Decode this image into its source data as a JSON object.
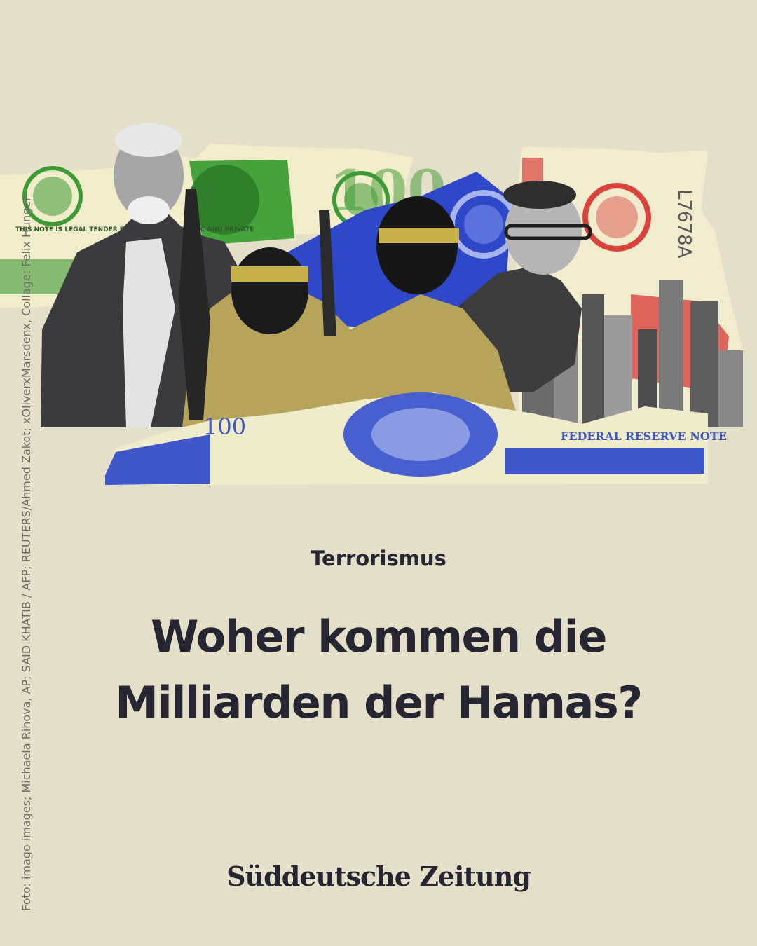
{
  "credit": "Foto: imago images; Michaela Rihova, AP; SAID KHATIB / AFP; REUTERS/Ahmed Zakot; xOliverxMarsdenx, Collage: Felix Hunger",
  "kicker": "Terrorismus",
  "headline": {
    "line1": "Woher kommen die",
    "line2": "Milliarden der Hamas?"
  },
  "brand": "Süddeutsche Zeitung",
  "collage": {
    "note_left_text": "THIS NOTE IS LEGAL TENDER FOR ALL DEBTS, PUBLIC AND PRIVATE",
    "note_left_serial": "100",
    "note_right_serial": "L7678A",
    "note_bottom_text": "FEDERAL RESERVE NOTE",
    "note_bottom_value": "100"
  },
  "colors": {
    "background": "#e3dfc8",
    "text": "#262633",
    "money_green": "#3e9a35",
    "money_blue": "#2f47c9",
    "money_red": "#d9433c",
    "paper": "#f3efd0"
  }
}
